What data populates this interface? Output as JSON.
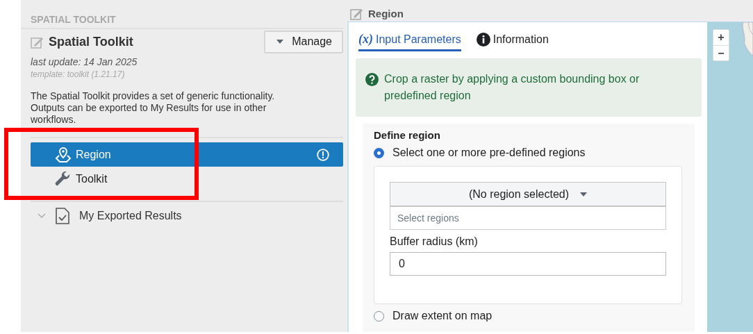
{
  "sidebar": {
    "header": "SPATIAL TOOLKIT",
    "title": "Spatial Toolkit",
    "manage_button": "Manage",
    "last_update": "last update: 14 Jan 2025",
    "template": "template: toolkit (1.21.17)",
    "description": "The Spatial Toolkit provides a set of generic functionality. Outputs can be exported to My Results for use in other workflows.",
    "nav": [
      {
        "label": "Region",
        "selected": true,
        "kind": "region",
        "warning": true
      },
      {
        "label": "Toolkit",
        "selected": false,
        "kind": "tool",
        "warning": false
      }
    ],
    "results": {
      "label": "My Exported Results"
    }
  },
  "panel": {
    "title": "Region",
    "tabs": [
      {
        "label": "Input Parameters",
        "selected": true,
        "kind": "params",
        "glyph": "(x)"
      },
      {
        "label": "Information",
        "selected": false,
        "kind": "info"
      }
    ],
    "notice": "Crop a raster by applying a custom bounding box or predefined region",
    "section": {
      "title": "Define region",
      "options": [
        {
          "label": "Select one or more pre-defined regions",
          "selected": true
        },
        {
          "label": "Draw extent on map",
          "selected": false
        }
      ],
      "dropdown": "(No region selected)",
      "search_placeholder": "Select regions",
      "buffer_label": "Buffer radius (km)",
      "buffer_value": "0"
    }
  },
  "map": {
    "zoom_in": "+",
    "zoom_out": "−"
  }
}
